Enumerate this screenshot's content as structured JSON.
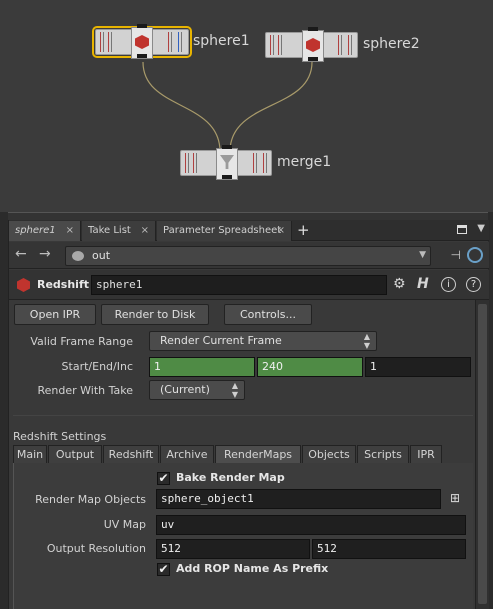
{
  "network": {
    "nodes": [
      {
        "id": "sphere1",
        "label": "sphere1",
        "selected": true,
        "icon": "sphere-icon"
      },
      {
        "id": "sphere2",
        "label": "sphere2",
        "selected": false,
        "icon": "sphere-icon"
      },
      {
        "id": "merge1",
        "label": "merge1",
        "selected": false,
        "icon": "merge-icon"
      }
    ]
  },
  "pane_tabs": [
    {
      "label": "sphere1",
      "active": true
    },
    {
      "label": "Take List",
      "active": false
    },
    {
      "label": "Parameter Spreadsheet",
      "active": false
    }
  ],
  "tab_close": "×",
  "tab_add": "+",
  "path": {
    "value": "out",
    "back": "←",
    "forward": "→",
    "drop": "▼",
    "pin": "📌"
  },
  "header": {
    "node_type": "Redshift",
    "node_name": "sphere1",
    "gear": "⚙",
    "hda": "H",
    "info": "i",
    "help": "?"
  },
  "buttons": {
    "open_ipr": "Open IPR",
    "render_to_disk": "Render to Disk",
    "controls": "Controls..."
  },
  "params": {
    "valid_frame_range_label": "Valid Frame Range",
    "valid_frame_range_value": "Render Current Frame",
    "start_end_inc_label": "Start/End/Inc",
    "start": "1",
    "end": "240",
    "inc": "1",
    "render_with_take_label": "Render With Take",
    "render_with_take_value": "(Current)"
  },
  "redshift_settings": {
    "title": "Redshift Settings",
    "tabs": [
      "Main",
      "Output",
      "Redshift",
      "Archive",
      "RenderMaps",
      "Objects",
      "Scripts",
      "IPR"
    ],
    "active_tab": "RenderMaps",
    "bake_render_map_label": "Bake Render Map",
    "bake_render_map_checked": true,
    "render_map_objects_label": "Render Map Objects",
    "render_map_objects_value": "sphere_object1",
    "uv_map_label": "UV Map",
    "uv_map_value": "uv",
    "output_resolution_label": "Output Resolution",
    "res_x": "512",
    "res_y": "512",
    "add_rop_prefix_label": "Add ROP Name As Prefix",
    "add_rop_prefix_checked": true,
    "checkmark": "✔"
  },
  "colors": {
    "selected_outline": "#e8b400",
    "node_icon": "#c0342e",
    "range_field": "#4f8b45",
    "wire": "#a89a6a"
  }
}
